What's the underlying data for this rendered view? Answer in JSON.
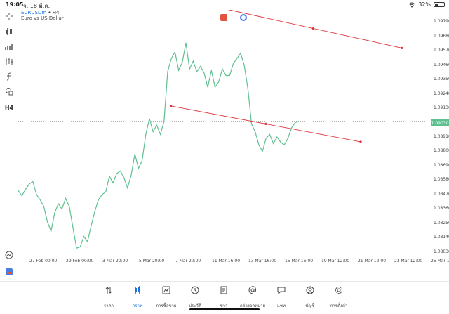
{
  "status_bar": {
    "time": "19:05",
    "date": "จ. 18 มี.ค.",
    "battery": "32%",
    "battery_level": 0.32
  },
  "toolbar": {
    "items": [
      {
        "icon": "crosshair-icon"
      },
      {
        "icon": "candles-icon"
      },
      {
        "icon": "indicators-icon"
      },
      {
        "icon": "bars-icon"
      },
      {
        "icon": "function-icon"
      },
      {
        "icon": "shapes-icon"
      },
      {
        "icon": "timeframe-label",
        "text": "H4"
      }
    ],
    "bottom_items": [
      {
        "icon": "quick-trade-icon"
      },
      {
        "icon": "one-click-icon"
      }
    ]
  },
  "chart": {
    "symbol": "EURUSDm",
    "timeframe": "• H4",
    "description": "Euro vs US Dollar",
    "current_price": "1.09030",
    "line_color": "#5fc08f",
    "trendline_color": "#e0333a",
    "price_labels": [
      "1.09790",
      "1.09680",
      "1.09570",
      "1.09460",
      "1.09350",
      "1.09240",
      "1.09130",
      "1.08910",
      "1.08800",
      "1.08690",
      "1.08580",
      "1.08470",
      "1.08360",
      "1.08250",
      "1.08140",
      "1.08030"
    ],
    "time_labels": [
      "27 Feb 00:00",
      "29 Feb 00:00",
      "3 Mar 20:00",
      "5 Mar 20:00",
      "7 Mar 20:00",
      "11 Mar 16:00",
      "13 Mar 16:00",
      "15 Mar 16:00",
      "19 Mar 12:00",
      "21 Mar 12:00",
      "23 Mar 12:00",
      "25 Mar 12:"
    ]
  },
  "chart_data": {
    "type": "line",
    "title": "",
    "xlabel": "",
    "ylabel": "",
    "ylim": [
      1.0797,
      1.0985
    ],
    "y": [
      1.085,
      1.0846,
      1.0851,
      1.0855,
      1.0857,
      1.0847,
      1.0843,
      1.0838,
      1.0826,
      1.0819,
      1.0833,
      1.084,
      1.0836,
      1.0844,
      1.0838,
      1.0822,
      1.0806,
      1.0807,
      1.0815,
      1.0811,
      1.0823,
      1.0834,
      1.0843,
      1.0847,
      1.0849,
      1.0861,
      1.0856,
      1.0863,
      1.0865,
      1.086,
      1.0852,
      1.0862,
      1.0878,
      1.0867,
      1.0873,
      1.0893,
      1.0905,
      1.0895,
      1.09,
      1.0893,
      1.0903,
      1.0941,
      1.0951,
      1.0956,
      1.0942,
      1.0948,
      1.0963,
      1.0943,
      1.0949,
      1.0941,
      1.0945,
      1.094,
      1.0929,
      1.0942,
      1.0929,
      1.0933,
      1.0943,
      1.0938,
      1.0938,
      1.0947,
      1.0951,
      1.0955,
      1.0946,
      1.0928,
      1.0901,
      1.0895,
      1.0885,
      1.088,
      1.089,
      1.0893,
      1.0886,
      1.0891,
      1.0887,
      1.0885,
      1.089,
      1.0898,
      1.0902,
      1.0903
    ],
    "trendlines": [
      {
        "start": [
          0.5,
          1.0989
        ],
        "end": [
          0.93,
          1.0959
        ]
      },
      {
        "start": [
          0.37,
          1.09147
        ],
        "end": [
          0.83,
          1.08873
        ]
      }
    ]
  },
  "bottom_nav": [
    {
      "icon": "quotes-icon",
      "label": "ราคา",
      "active": false
    },
    {
      "icon": "chart-icon",
      "label": "กราฟ",
      "active": true
    },
    {
      "icon": "trade-icon",
      "label": "การซื้อขาย",
      "active": false
    },
    {
      "icon": "history-icon",
      "label": "ประวัติ",
      "active": false
    },
    {
      "icon": "news-icon",
      "label": "ข่าว",
      "active": false
    },
    {
      "icon": "mailbox-icon",
      "label": "กล่องจดหมาย",
      "active": false
    },
    {
      "icon": "chat-icon",
      "label": "แชท",
      "active": false
    },
    {
      "icon": "account-icon",
      "label": "บัญชี",
      "active": false
    },
    {
      "icon": "settings-icon",
      "label": "การตั้งค่า",
      "active": false
    }
  ]
}
